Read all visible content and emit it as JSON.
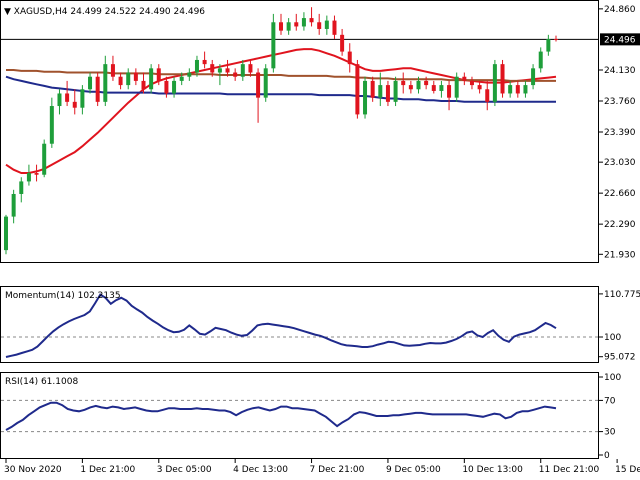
{
  "colors": {
    "background": "#ffffff",
    "frame": "#000000",
    "bull": "#1e9e3a",
    "bear": "#e0141e",
    "wick": "#444444",
    "ma_fast": "#e0141e",
    "ma_mid": "#a0522d",
    "ma_slow": "#1f2a8c",
    "osc_line": "#1f2a8c",
    "price_tag_bg": "#000000",
    "price_tag_fg": "#ffffff",
    "dashed_level": "#888888"
  },
  "chart_data": [
    {
      "type": "candlestick",
      "title": "XAGUSD,H4",
      "ohlc_readout": [
        "24.499",
        "24.522",
        "24.490",
        "24.496"
      ],
      "current_price": 24.496,
      "current_price_label": "24.496",
      "ylim": [
        21.85,
        24.93
      ],
      "ytick_values": [
        24.86,
        24.13,
        23.76,
        23.39,
        23.03,
        22.66,
        22.29,
        21.93
      ],
      "ytick_labels": [
        "24.860",
        "24.130",
        "23.760",
        "23.390",
        "23.030",
        "22.660",
        "22.290",
        "21.930"
      ],
      "xtick_labels": [
        "30 Nov 2020",
        "1 Dec 21:00",
        "3 Dec 05:00",
        "4 Dec 13:00",
        "7 Dec 21:00",
        "9 Dec 05:00",
        "10 Dec 13:00",
        "11 Dec 21:00",
        "15 Dec 05:00"
      ],
      "xtick_index": [
        0,
        10,
        20,
        30,
        40,
        50,
        60,
        70,
        80
      ],
      "candles": [
        [
          21.98,
          22.4,
          21.93,
          22.38
        ],
        [
          22.38,
          22.7,
          22.3,
          22.65
        ],
        [
          22.65,
          22.85,
          22.55,
          22.8
        ],
        [
          22.8,
          23.0,
          22.75,
          22.9
        ],
        [
          22.9,
          23.0,
          22.8,
          22.88
        ],
        [
          22.88,
          23.3,
          22.85,
          23.25
        ],
        [
          23.25,
          23.8,
          23.2,
          23.7
        ],
        [
          23.7,
          23.9,
          23.6,
          23.85
        ],
        [
          23.85,
          24.0,
          23.7,
          23.75
        ],
        [
          23.75,
          23.9,
          23.6,
          23.68
        ],
        [
          23.68,
          23.95,
          23.6,
          23.9
        ],
        [
          23.9,
          24.1,
          23.85,
          24.05
        ],
        [
          24.05,
          24.1,
          23.7,
          23.75
        ],
        [
          23.75,
          24.3,
          23.7,
          24.2
        ],
        [
          24.2,
          24.3,
          24.0,
          24.05
        ],
        [
          24.05,
          24.1,
          23.9,
          23.95
        ],
        [
          23.95,
          24.15,
          23.9,
          24.1
        ],
        [
          24.1,
          24.15,
          23.95,
          24.0
        ],
        [
          24.0,
          24.1,
          23.85,
          23.9
        ],
        [
          23.9,
          24.2,
          23.85,
          24.15
        ],
        [
          24.15,
          24.2,
          23.95,
          24.0
        ],
        [
          24.0,
          24.05,
          23.8,
          23.85
        ],
        [
          23.85,
          24.05,
          23.8,
          24.0
        ],
        [
          24.0,
          24.1,
          23.95,
          24.05
        ],
        [
          24.05,
          24.15,
          24.0,
          24.1
        ],
        [
          24.1,
          24.3,
          24.05,
          24.25
        ],
        [
          24.25,
          24.35,
          24.15,
          24.2
        ],
        [
          24.2,
          24.25,
          24.05,
          24.1
        ],
        [
          24.1,
          24.2,
          23.95,
          24.15
        ],
        [
          24.15,
          24.25,
          24.05,
          24.1
        ],
        [
          24.1,
          24.15,
          24.0,
          24.05
        ],
        [
          24.05,
          24.25,
          24.0,
          24.2
        ],
        [
          24.2,
          24.25,
          24.05,
          24.1
        ],
        [
          24.1,
          24.15,
          23.5,
          23.8
        ],
        [
          23.8,
          24.2,
          23.75,
          24.15
        ],
        [
          24.15,
          24.8,
          24.1,
          24.7
        ],
        [
          24.7,
          24.8,
          24.55,
          24.6
        ],
        [
          24.6,
          24.75,
          24.55,
          24.7
        ],
        [
          24.7,
          24.8,
          24.6,
          24.65
        ],
        [
          24.65,
          24.82,
          24.6,
          24.75
        ],
        [
          24.75,
          24.88,
          24.65,
          24.7
        ],
        [
          24.7,
          24.8,
          24.55,
          24.62
        ],
        [
          24.62,
          24.78,
          24.55,
          24.72
        ],
        [
          24.72,
          24.78,
          24.5,
          24.55
        ],
        [
          24.55,
          24.62,
          24.3,
          24.35
        ],
        [
          24.35,
          24.45,
          24.1,
          24.2
        ],
        [
          24.2,
          24.25,
          23.55,
          23.6
        ],
        [
          23.6,
          24.05,
          23.55,
          24.0
        ],
        [
          24.0,
          24.05,
          23.75,
          23.8
        ],
        [
          23.8,
          24.1,
          23.7,
          23.95
        ],
        [
          23.95,
          24.0,
          23.7,
          23.75
        ],
        [
          23.75,
          24.05,
          23.7,
          24.0
        ],
        [
          24.0,
          24.1,
          23.85,
          23.95
        ],
        [
          23.95,
          24.0,
          23.85,
          23.9
        ],
        [
          23.9,
          24.05,
          23.85,
          24.0
        ],
        [
          24.0,
          24.05,
          23.9,
          23.95
        ],
        [
          23.95,
          24.0,
          23.85,
          23.88
        ],
        [
          23.88,
          24.0,
          23.8,
          23.95
        ],
        [
          23.95,
          24.0,
          23.65,
          23.8
        ],
        [
          23.8,
          24.1,
          23.75,
          24.05
        ],
        [
          24.05,
          24.1,
          23.95,
          24.0
        ],
        [
          24.0,
          24.05,
          23.9,
          23.95
        ],
        [
          23.95,
          24.0,
          23.85,
          23.9
        ],
        [
          23.9,
          24.0,
          23.65,
          23.75
        ],
        [
          23.75,
          24.25,
          23.7,
          24.2
        ],
        [
          24.2,
          24.25,
          23.8,
          23.85
        ],
        [
          23.85,
          24.0,
          23.8,
          23.95
        ],
        [
          23.95,
          24.0,
          23.8,
          23.85
        ],
        [
          23.85,
          24.0,
          23.8,
          23.95
        ],
        [
          23.95,
          24.2,
          23.9,
          24.15
        ],
        [
          24.15,
          24.4,
          24.1,
          24.35
        ],
        [
          24.35,
          24.55,
          24.3,
          24.5
        ],
        [
          24.5,
          24.54,
          24.47,
          24.496
        ]
      ],
      "overlays": [
        {
          "values": [
            23.0,
            22.94,
            22.9,
            22.9,
            22.92,
            22.95,
            23.0,
            23.05,
            23.1,
            23.15,
            23.22,
            23.3,
            23.38,
            23.47,
            23.56,
            23.65,
            23.74,
            23.82,
            23.9,
            23.96,
            24.0,
            24.03,
            24.05,
            24.07,
            24.09,
            24.11,
            24.13,
            24.15,
            24.17,
            24.19,
            24.21,
            24.23,
            24.25,
            24.27,
            24.29,
            24.31,
            24.33,
            24.35,
            24.37,
            24.38,
            24.38,
            24.36,
            24.33,
            24.3,
            24.26,
            24.22,
            24.18,
            24.14,
            24.12,
            24.12,
            24.13,
            24.14,
            24.15,
            24.15,
            24.13,
            24.11,
            24.09,
            24.07,
            24.05,
            24.03,
            24.01,
            24.0,
            23.99,
            23.98,
            23.98,
            23.98,
            23.99,
            24.0,
            24.01,
            24.02,
            24.03,
            24.04,
            24.05
          ]
        },
        {
          "values": [
            24.13,
            24.13,
            24.12,
            24.12,
            24.12,
            24.11,
            24.11,
            24.11,
            24.1,
            24.1,
            24.1,
            24.1,
            24.1,
            24.1,
            24.09,
            24.09,
            24.09,
            24.09,
            24.09,
            24.09,
            24.08,
            24.08,
            24.08,
            24.08,
            24.08,
            24.08,
            24.08,
            24.08,
            24.07,
            24.07,
            24.07,
            24.07,
            24.07,
            24.07,
            24.07,
            24.07,
            24.07,
            24.06,
            24.06,
            24.06,
            24.06,
            24.06,
            24.06,
            24.05,
            24.05,
            24.05,
            24.04,
            24.04,
            24.03,
            24.03,
            24.03,
            24.02,
            24.02,
            24.02,
            24.02,
            24.02,
            24.02,
            24.02,
            24.01,
            24.01,
            24.01,
            24.01,
            24.01,
            24.01,
            24.01,
            24.01,
            24.0,
            24.0,
            24.0,
            24.0,
            24.0,
            24.0,
            24.0
          ]
        },
        {
          "values": [
            24.05,
            24.02,
            24.0,
            23.98,
            23.96,
            23.94,
            23.92,
            23.91,
            23.9,
            23.89,
            23.88,
            23.87,
            23.87,
            23.86,
            23.86,
            23.86,
            23.86,
            23.86,
            23.86,
            23.86,
            23.85,
            23.85,
            23.85,
            23.85,
            23.85,
            23.85,
            23.85,
            23.85,
            23.85,
            23.84,
            23.84,
            23.84,
            23.84,
            23.84,
            23.84,
            23.84,
            23.84,
            23.84,
            23.84,
            23.84,
            23.84,
            23.83,
            23.83,
            23.83,
            23.83,
            23.83,
            23.82,
            23.82,
            23.81,
            23.8,
            23.79,
            23.79,
            23.78,
            23.78,
            23.78,
            23.77,
            23.77,
            23.76,
            23.76,
            23.76,
            23.75,
            23.75,
            23.75,
            23.75,
            23.75,
            23.75,
            23.75,
            23.75,
            23.75,
            23.75,
            23.75,
            23.75,
            23.75
          ]
        }
      ]
    },
    {
      "type": "line",
      "title": "Momentum(14) 102.2135",
      "ylim": [
        94.0,
        112.0
      ],
      "ytick_values": [
        110.7757,
        100,
        95.072
      ],
      "ytick_labels": [
        "110.7757",
        "100",
        "95.072"
      ],
      "reference_level": 100,
      "series": [
        {
          "values": [
            95.0,
            95.3,
            95.6,
            96.0,
            96.4,
            96.8,
            97.6,
            98.9,
            100.2,
            101.4,
            102.4,
            103.2,
            103.9,
            104.5,
            105.0,
            105.5,
            106.4,
            108.4,
            110.6,
            109.8,
            108.3,
            109.2,
            109.8,
            109.1,
            107.8,
            106.9,
            106.1,
            105.0,
            104.1,
            103.3,
            102.4,
            101.7,
            101.2,
            101.3,
            101.8,
            102.9,
            101.9,
            100.8,
            100.6,
            101.4,
            102.3,
            102.0,
            101.7,
            101.1,
            100.6,
            100.3,
            100.5,
            101.6,
            102.9,
            103.2,
            103.3,
            103.1,
            102.9,
            102.7,
            102.5,
            102.2,
            101.8,
            101.4,
            101.0,
            100.6,
            100.3,
            99.8,
            99.2,
            98.7,
            98.2,
            97.9,
            97.8,
            97.7,
            97.5,
            97.5,
            97.7,
            98.1,
            98.4,
            98.8,
            98.7,
            98.3,
            97.9,
            97.8,
            97.9,
            98.0,
            98.3,
            98.5,
            98.4,
            98.4,
            98.6,
            99.0,
            99.5,
            100.2,
            101.1,
            101.4,
            100.4,
            100.0,
            101.0,
            101.7,
            100.3,
            99.3,
            98.8,
            100.1,
            100.6,
            100.9,
            101.2,
            101.7,
            102.6,
            103.5,
            103.0,
            102.2
          ]
        }
      ]
    },
    {
      "type": "line",
      "title": "RSI(14) 61.1008",
      "ylim": [
        0,
        100
      ],
      "ytick_values": [
        100,
        70,
        30,
        0
      ],
      "ytick_labels": [
        "100",
        "70",
        "30",
        "0"
      ],
      "levels": [
        70,
        30
      ],
      "series": [
        {
          "values": [
            32,
            36,
            41,
            45,
            51,
            56,
            61,
            64,
            67,
            67,
            64,
            59,
            57,
            56,
            58,
            61,
            63,
            61,
            60,
            62,
            61,
            59,
            60,
            61,
            59,
            57,
            56,
            56,
            58,
            60,
            60,
            59,
            59,
            59,
            60,
            59,
            59,
            58,
            57,
            57,
            55,
            51,
            55,
            58,
            60,
            61,
            59,
            57,
            59,
            62,
            62,
            60,
            60,
            59,
            58,
            57,
            53,
            49,
            43,
            37,
            42,
            46,
            52,
            55,
            54,
            52,
            50,
            50,
            50,
            51,
            51,
            52,
            53,
            54,
            54,
            53,
            52,
            52,
            52,
            52,
            52,
            52,
            52,
            51,
            50,
            49,
            51,
            53,
            52,
            47,
            49,
            54,
            56,
            56,
            58,
            60,
            62,
            61,
            60
          ]
        }
      ]
    }
  ]
}
